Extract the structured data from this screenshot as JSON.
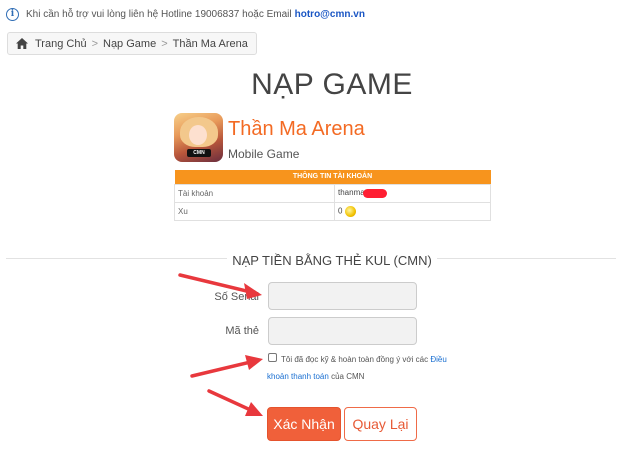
{
  "topbar": {
    "icon": "info-icon",
    "text": "Khi cần hỗ trợ vui lòng liên hệ Hotline 19006837 hoặc Email",
    "email": "hotro@cmn.vn"
  },
  "breadcrumb": {
    "icon": "home-icon",
    "items": [
      "Trang Chủ",
      "Nạp Game",
      "Thần Ma Arena"
    ],
    "separator": ">"
  },
  "page_title": "NẠP GAME",
  "game": {
    "logo_badge": "CMN",
    "name": "Thần Ma Arena",
    "type": "Mobile Game"
  },
  "account_table": {
    "header": "THÔNG TIN TÀI KHOẢN",
    "rows": [
      {
        "label": "Tài khoản",
        "value": "thanma"
      },
      {
        "label": "Xu",
        "value": "0"
      }
    ]
  },
  "form": {
    "section_title": "NẠP TIỀN BẰNG THẺ KUL (CMN)",
    "serial_label": "Số Serial",
    "serial_value": "",
    "code_label": "Mã thẻ",
    "code_value": "",
    "terms_before": "Tôi đã đọc kỹ & hoàn toàn đồng ý với các",
    "terms_link": "Điều khoản thanh toán",
    "terms_after": "của CMN",
    "terms_checked": false,
    "submit_label": "Xác Nhận",
    "back_label": "Quay Lại"
  },
  "colors": {
    "accent": "#f36a23",
    "table_header": "#f7941d",
    "submit_bg": "#f0603a",
    "link": "#1a6fd1",
    "annotation_arrow": "#e8383d"
  }
}
